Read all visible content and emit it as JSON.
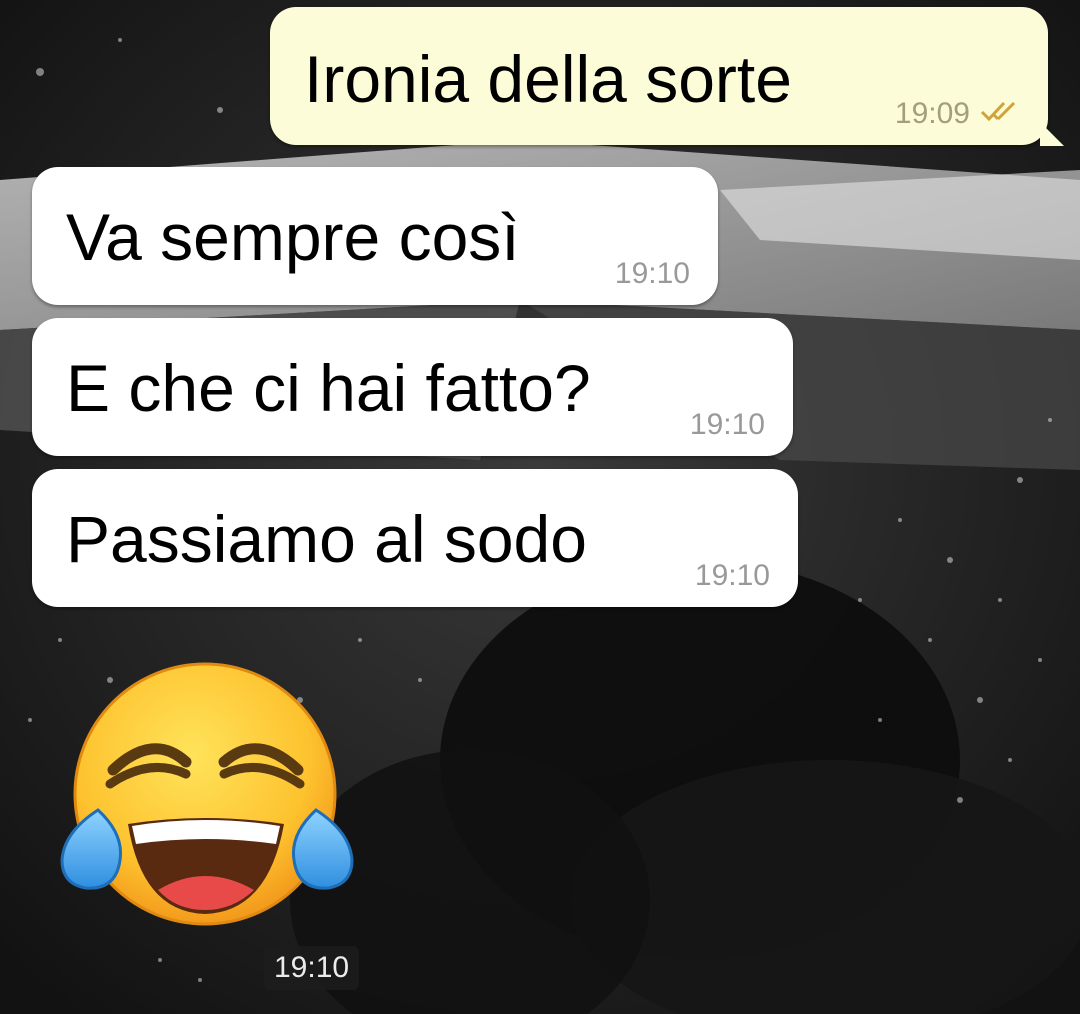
{
  "chat": {
    "messages": [
      {
        "direction": "outgoing",
        "text": "Ironia della sorte",
        "time": "19:09",
        "status": "read-double-check-icon"
      },
      {
        "direction": "incoming",
        "text": "Va sempre così",
        "time": "19:10"
      },
      {
        "direction": "incoming",
        "text": "E che ci hai fatto?",
        "time": "19:10"
      },
      {
        "direction": "incoming",
        "text": "Passiamo al sodo",
        "time": "19:10"
      },
      {
        "direction": "incoming",
        "type": "emoji",
        "emoji": "face-with-tears-of-joy",
        "time": "19:10"
      }
    ]
  },
  "colors": {
    "outgoing_bubble": "#fcfcd9",
    "incoming_bubble": "#ffffff",
    "read_ticks": "#d1a238"
  }
}
